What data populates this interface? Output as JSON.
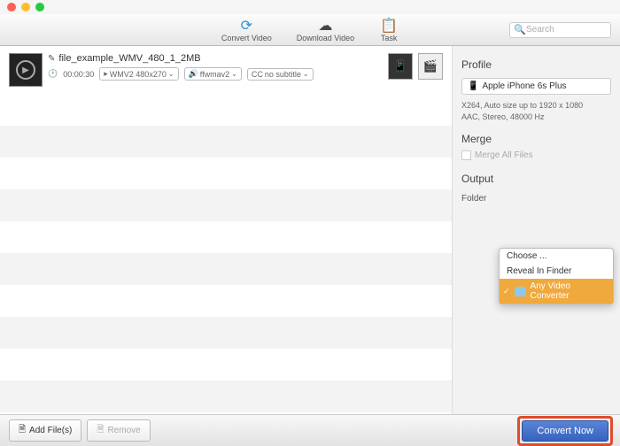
{
  "toolbar": {
    "items": [
      {
        "label": "Convert Video",
        "icon": "↻"
      },
      {
        "label": "Download Video",
        "icon": "☁"
      },
      {
        "label": "Task",
        "icon": "📋"
      }
    ],
    "search_placeholder": "Search"
  },
  "file": {
    "name": "file_example_WMV_480_1_2MB",
    "duration": "00:00:30",
    "format_selected": "WMV2 480x270",
    "audio_selected": "ffwmav2",
    "subtitle_selected": "no subtitle",
    "cc_label": "CC"
  },
  "sidebar": {
    "profile_title": "Profile",
    "profile_selected": "Apple iPhone 6s Plus",
    "profile_line1": "X264, Auto size up to 1920 x 1080",
    "profile_line2": "AAC, Stereo, 48000 Hz",
    "merge_title": "Merge",
    "merge_label": "Merge All Files",
    "output_title": "Output",
    "folder_label": "Folder"
  },
  "popup": {
    "choose": "Choose ...",
    "reveal": "Reveal In Finder",
    "selected": "Any Video Converter"
  },
  "bottom": {
    "add_files": "Add File(s)",
    "remove": "Remove",
    "convert": "Convert Now"
  }
}
